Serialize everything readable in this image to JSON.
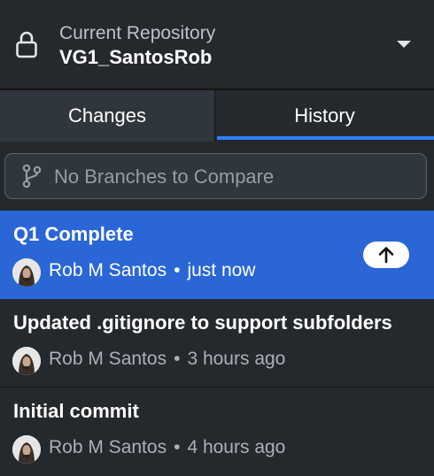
{
  "repository": {
    "caption": "Current Repository",
    "name": "VG1_SantosRob",
    "icon": "lock-icon",
    "dropdown_icon": "caret-down-icon"
  },
  "tabs": [
    {
      "label": "Changes",
      "selected": false
    },
    {
      "label": "History",
      "selected": true
    }
  ],
  "compare": {
    "icon": "git-branch-icon",
    "text": "No Branches to Compare"
  },
  "commits": [
    {
      "title": "Q1 Complete",
      "author": "Rob M Santos",
      "separator": "•",
      "time": "just now",
      "selected": true,
      "unpushed": true,
      "push_icon": "arrow-up-icon"
    },
    {
      "title": "Updated .gitignore to support subfolders",
      "author": "Rob M Santos",
      "separator": "•",
      "time": "3 hours ago",
      "selected": false,
      "unpushed": false
    },
    {
      "title": "Initial commit",
      "author": "Rob M Santos",
      "separator": "•",
      "time": "4 hours ago",
      "selected": false,
      "unpushed": false
    }
  ],
  "colors": {
    "background": "#24292e",
    "accent": "#2f81f7",
    "selected_row": "#2a66d6"
  }
}
